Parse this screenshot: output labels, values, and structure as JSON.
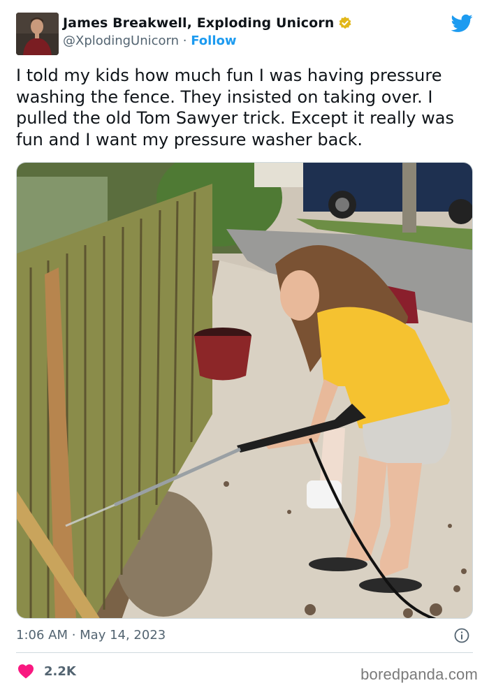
{
  "author": {
    "display_name": "James Breakwell, Exploding Unicorn",
    "handle": "@XplodingUnicorn",
    "separator": "·",
    "follow_label": "Follow",
    "verified": true,
    "avatar_icon": "profile-photo"
  },
  "tweet": {
    "text": "I told my kids how much fun I was having pressure washing the fence. They insisted on taking over. I pulled the old Tom Sawyer trick. Except it really was fun and I want my pressure washer back.",
    "timestamp": "1:06 AM · May 14, 2023"
  },
  "engagement": {
    "likes": "2.2K"
  },
  "watermark": "boredpanda.com",
  "colors": {
    "brand_blue": "#1d9bf0",
    "like_red": "#f91880",
    "verified_gold": "#e2b719",
    "secondary_text": "#536471"
  }
}
